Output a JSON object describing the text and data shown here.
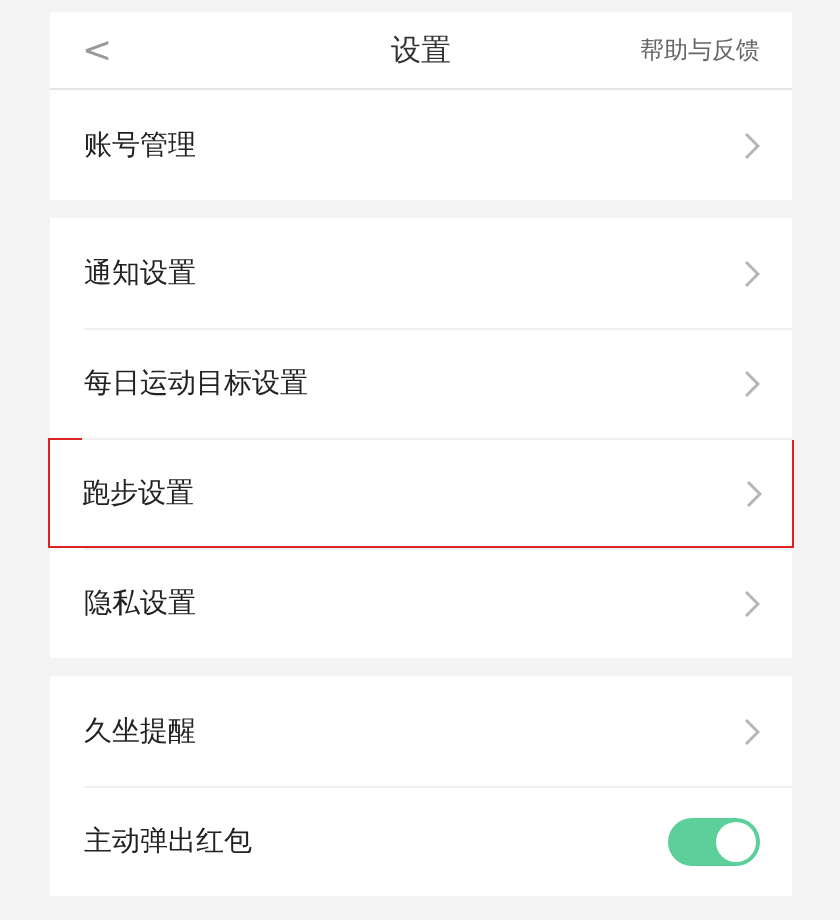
{
  "header": {
    "back": "<",
    "title": "设置",
    "action": "帮助与反馈"
  },
  "sections": [
    {
      "items": [
        {
          "label": "账号管理",
          "kind": "link",
          "highlighted": false
        }
      ]
    },
    {
      "items": [
        {
          "label": "通知设置",
          "kind": "link",
          "highlighted": false
        },
        {
          "label": "每日运动目标设置",
          "kind": "link",
          "highlighted": false
        },
        {
          "label": "跑步设置",
          "kind": "link",
          "highlighted": true
        },
        {
          "label": "隐私设置",
          "kind": "link",
          "highlighted": false
        }
      ]
    },
    {
      "items": [
        {
          "label": "久坐提醒",
          "kind": "link",
          "highlighted": false
        },
        {
          "label": "主动弹出红包",
          "kind": "toggle",
          "on": true,
          "highlighted": false
        }
      ]
    }
  ]
}
